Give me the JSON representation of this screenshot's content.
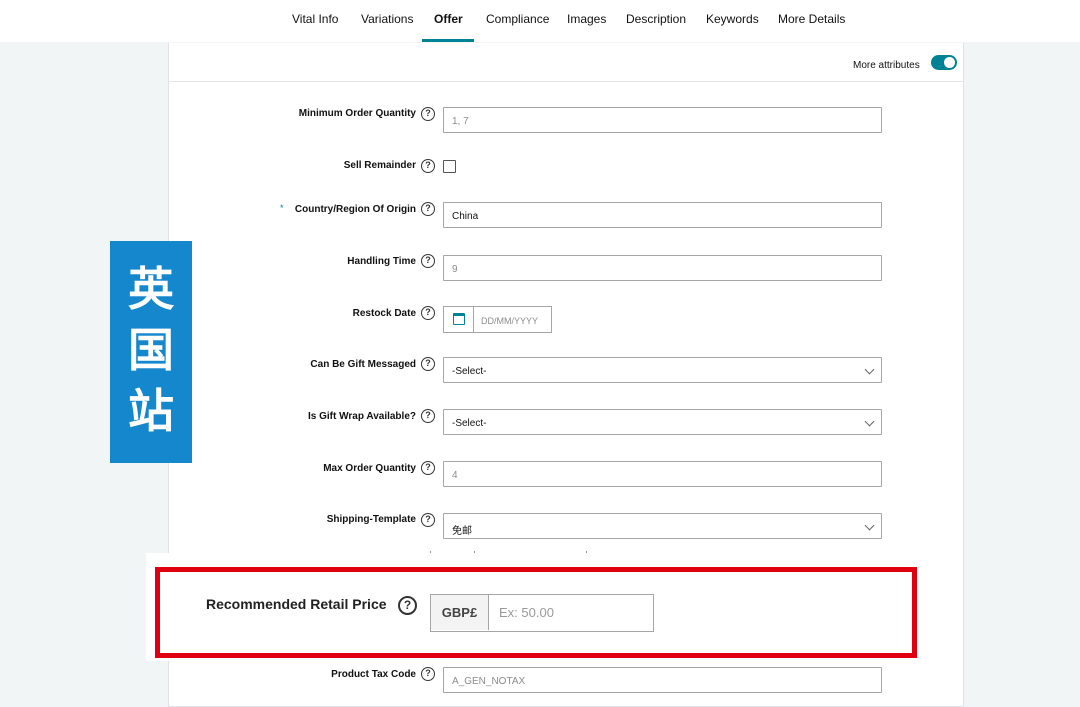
{
  "tabs": [
    {
      "label": "Vital Info"
    },
    {
      "label": "Variations"
    },
    {
      "label": "Offer",
      "active": true
    },
    {
      "label": "Compliance"
    },
    {
      "label": "Images"
    },
    {
      "label": "Description"
    },
    {
      "label": "Keywords"
    },
    {
      "label": "More Details"
    }
  ],
  "header": {
    "more_attributes_label": "More attributes",
    "more_attributes_on": true
  },
  "help_glyph": "?",
  "form": {
    "minimum_order_quantity": {
      "label": "Minimum Order Quantity",
      "placeholder": "1, 7"
    },
    "sell_remainder": {
      "label": "Sell Remainder",
      "checked": false
    },
    "country_of_origin": {
      "label": "Country/Region Of Origin",
      "value": "China",
      "required_mark": "*"
    },
    "handling_time": {
      "label": "Handling Time",
      "placeholder": "9"
    },
    "restock_date": {
      "label": "Restock Date",
      "placeholder": "DD/MM/YYYY"
    },
    "gift_messaged": {
      "label": "Can Be Gift Messaged",
      "value": "-Select-"
    },
    "gift_wrap": {
      "label": "Is Gift Wrap Available?",
      "value": "-Select-"
    },
    "max_order_quantity": {
      "label": "Max Order Quantity",
      "placeholder": "4"
    },
    "shipping_template": {
      "label": "Shipping-Template",
      "value": "免邮"
    },
    "recommended_retail_price": {
      "label": "Recommended Retail Price",
      "currency": "GBP£",
      "placeholder": "Ex: 50.00"
    },
    "product_tax_code": {
      "label": "Product Tax Code",
      "value": "A_GEN_NOTAX"
    }
  },
  "overlay_badge": {
    "chars": [
      "英",
      "国",
      "站"
    ]
  },
  "colors": {
    "accent": "#008296",
    "highlight_frame": "#e0000f",
    "badge_bg": "#1587cc"
  }
}
